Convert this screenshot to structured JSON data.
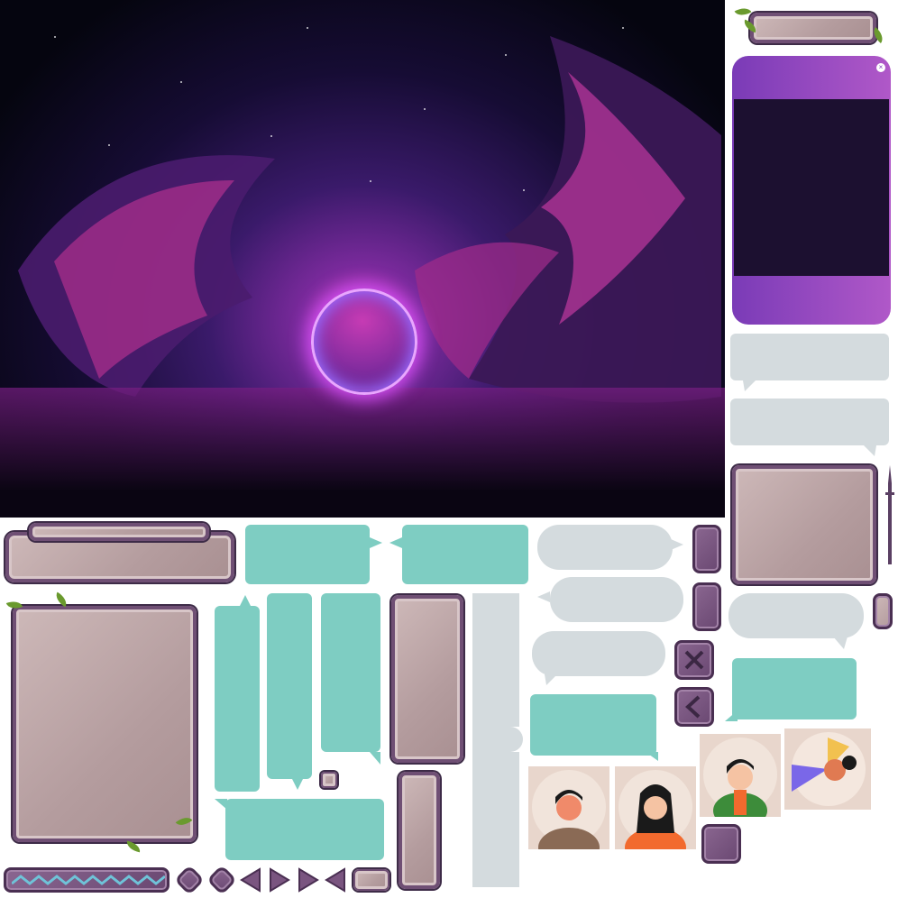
{
  "assets": {
    "scene": "neon-portal-background",
    "close_icon": "×",
    "icons": [
      "x-icon",
      "chevron-left-icon",
      "chevron-right-icon",
      "diamond-icon",
      "triangle-left-icon",
      "triangle-right-icon"
    ]
  },
  "colors": {
    "teal": "#7ecdc2",
    "grey": "#d4dbde",
    "stone": "#b49c9e",
    "stone_border": "#6f4f74",
    "purple": "#7a3bb7",
    "neon": "#d04df0"
  }
}
